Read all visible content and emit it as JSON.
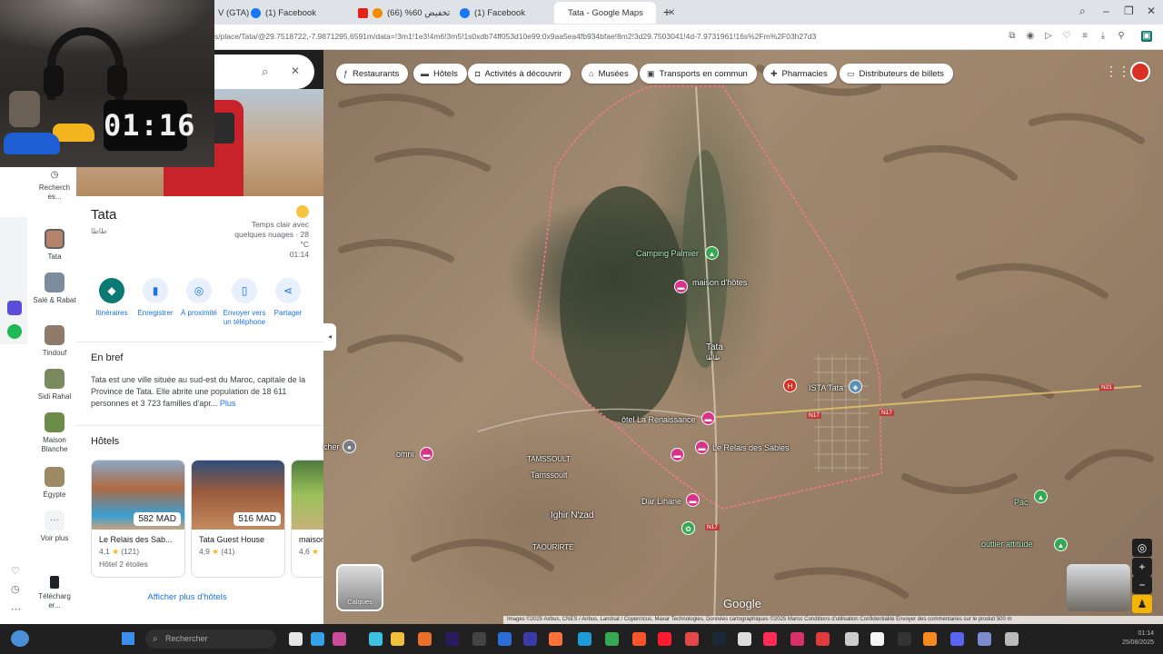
{
  "browser": {
    "tabs": [
      {
        "label": "V (GTA)"
      },
      {
        "label": "(1) Facebook"
      },
      {
        "label": "تخفيض 60% (66)"
      },
      {
        "label": "(1) Facebook"
      },
      {
        "label": "Tata - Google Maps"
      }
    ],
    "url": "s/place/Tata/@29.7518722,-7.9871295,6591m/data=!3m1!1e3!4m6!3m5!1s0xdb74ff053d10e99:0x9aa5ea4fb934bfae!8m2!3d29.7503041!4d-7.9731961!16s%2Fm%2F03h27d3"
  },
  "webcam": {
    "clock": "01:16"
  },
  "rail": {
    "items": [
      {
        "label": "Recherch es..."
      },
      {
        "label": "Tata"
      },
      {
        "label": "Salé & Rabat"
      },
      {
        "label": "Tindouf"
      },
      {
        "label": "Sidi Rahal"
      },
      {
        "label": "Maison Blanche"
      },
      {
        "label": "Égypte"
      },
      {
        "label": "Voir plus"
      },
      {
        "label": "Télécharg er..."
      }
    ]
  },
  "place": {
    "title": "Tata",
    "subtitle_ar": "طاطا",
    "weather_line1": "Temps clair avec",
    "weather_line2": "quelques nuages · 28",
    "weather_line3": "°C",
    "time": "01:14",
    "actions": [
      {
        "label": "Itinéraires",
        "icon": "directions-icon"
      },
      {
        "label": "Enregistrer",
        "icon": "bookmark-icon"
      },
      {
        "label": "À proximité",
        "icon": "nearby-icon"
      },
      {
        "label": "Envoyer vers un téléphone",
        "icon": "phone-icon"
      },
      {
        "label": "Partager",
        "icon": "share-icon"
      }
    ],
    "brief_title": "En bref",
    "brief_text": "Tata est une ville située au sud-est du Maroc, capitale de la Province de Tata. Elle abrite une population de 18 611 personnes et 3 723 familles d'apr...",
    "brief_more": "Plus",
    "hotels_title": "Hôtels",
    "hotels": [
      {
        "name": "Le Relais des Sab...",
        "price": "582 MAD",
        "rating": "4,1",
        "reviews": "(121)",
        "class": "Hôtel 2 étoiles"
      },
      {
        "name": "Tata Guest House",
        "price": "516 MAD",
        "rating": "4,9",
        "reviews": "(41)",
        "class": ""
      },
      {
        "name": "maison",
        "price": "",
        "rating": "4,6",
        "reviews": "",
        "class": ""
      }
    ],
    "show_more": "Afficher plus d'hôtels"
  },
  "map": {
    "chips": [
      {
        "label": "Restaurants",
        "icon": "fork-knife-icon"
      },
      {
        "label": "Hôtels",
        "icon": "bed-icon"
      },
      {
        "label": "Activités à découvrir",
        "icon": "camera-icon"
      },
      {
        "label": "Musées",
        "icon": "museum-icon"
      },
      {
        "label": "Transports en commun",
        "icon": "bus-icon"
      },
      {
        "label": "Pharmacies",
        "icon": "pharmacy-icon"
      },
      {
        "label": "Distributeurs de billets",
        "icon": "atm-icon"
      }
    ],
    "labels": {
      "camping": "Camping Palmier",
      "maison": "maison d'hôtes",
      "tata": "Tata",
      "tata_ar": "طاطا",
      "ista": "ISTA Tata",
      "renaissance": "ôtel La Renaissance",
      "relais": "Le Relais des Sables",
      "tamssoult_caps": "TAMSSOULT",
      "tamssoult": "Tamssoult",
      "ighir": "Ighir N'zad",
      "taourirte": "TAOURIRTE",
      "dar": "Dar Lihane",
      "outlier": "outlier attitude",
      "pac": "Pac",
      "cher": "cher",
      "omni": "omni"
    },
    "roads": [
      "N21",
      "N17",
      "N17",
      "N17"
    ],
    "calques": "Calques",
    "google": "Google",
    "attribution": "Images ©2025 Airbus, CNES / Airbus, Landsat / Copernicus, Maxar Technologies, Données cartographiques ©2025   Maroc   Conditions d'utilisation   Confidentialité   Envoyer des commentaires sur le produit   500 m"
  },
  "taskbar": {
    "search": "Rechercher",
    "time": "01:14",
    "date": "25/08/2025"
  }
}
